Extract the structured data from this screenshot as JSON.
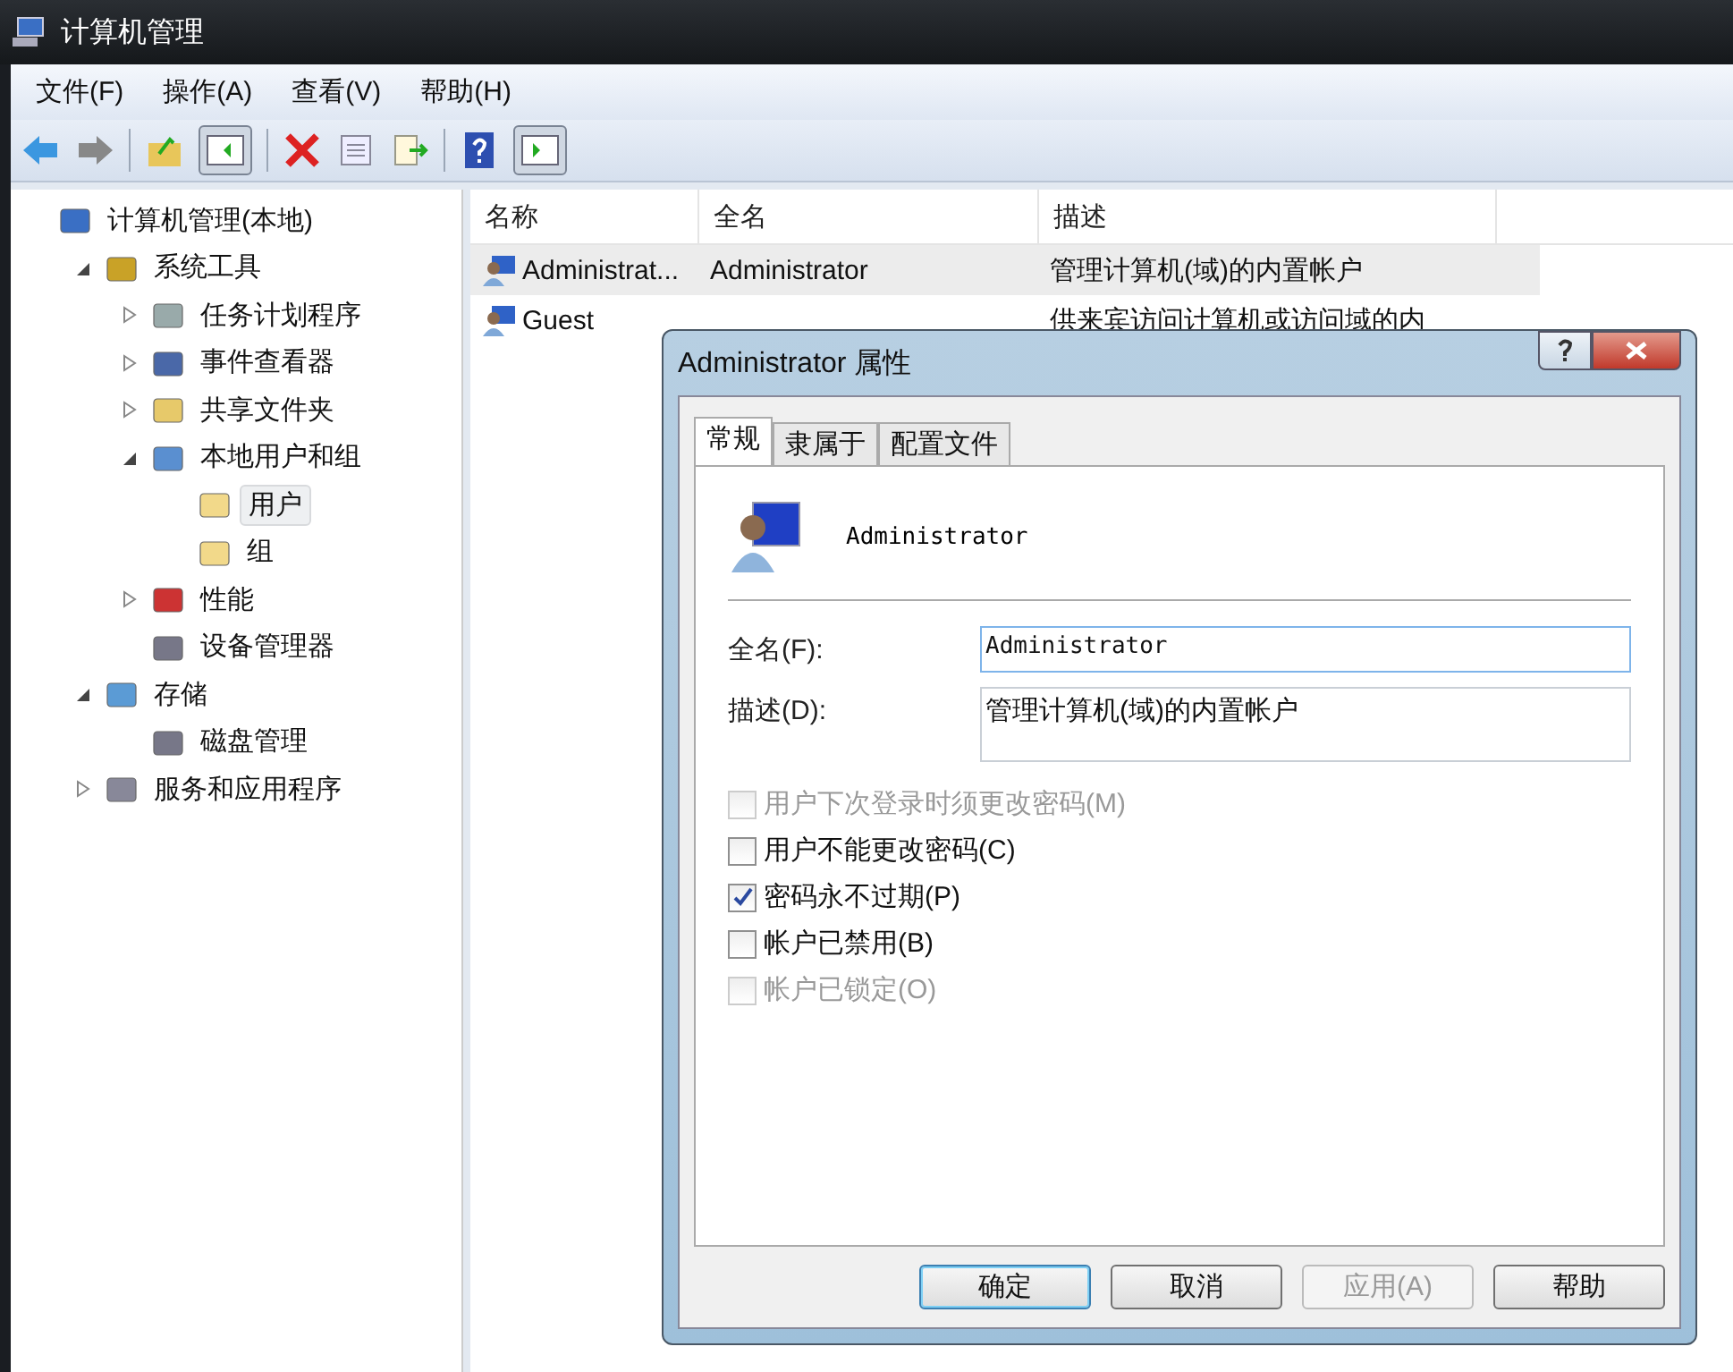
{
  "window": {
    "title": "计算机管理"
  },
  "menu": [
    "文件(F)",
    "操作(A)",
    "查看(V)",
    "帮助(H)"
  ],
  "tree": [
    {
      "label": "计算机管理(本地)",
      "selected": false,
      "children": [
        {
          "label": "系统工具",
          "expanded": true,
          "selected": false,
          "children": [
            {
              "label": "任务计划程序",
              "expanded": false,
              "selected": false
            },
            {
              "label": "事件查看器",
              "expanded": false,
              "selected": false
            },
            {
              "label": "共享文件夹",
              "expanded": false,
              "selected": false
            },
            {
              "label": "本地用户和组",
              "expanded": true,
              "selected": false,
              "children": [
                {
                  "label": "用户",
                  "selected": true
                },
                {
                  "label": "组",
                  "selected": false
                }
              ]
            },
            {
              "label": "性能",
              "expanded": false,
              "selected": false
            },
            {
              "label": "设备管理器",
              "selected": false
            }
          ]
        },
        {
          "label": "存储",
          "expanded": true,
          "selected": false,
          "children": [
            {
              "label": "磁盘管理",
              "selected": false
            }
          ]
        },
        {
          "label": "服务和应用程序",
          "expanded": false,
          "selected": false
        }
      ]
    }
  ],
  "table": {
    "columns": [
      "名称",
      "全名",
      "描述"
    ],
    "rows": [
      {
        "cells": [
          "Administrat...",
          "Administrator",
          "管理计算机(域)的内置帐户"
        ],
        "selected": true
      },
      {
        "cells": [
          "Guest",
          "",
          "供来宾访问计算机或访问域的内"
        ],
        "selected": false
      }
    ]
  },
  "dialog": {
    "title": "Administrator 属性",
    "tabs": [
      {
        "label": "常规",
        "selected": true
      },
      {
        "label": "隶属于",
        "selected": false
      },
      {
        "label": "配置文件",
        "selected": false
      }
    ],
    "user_name": "Administrator",
    "fields": [
      {
        "label": "全名(F):",
        "value": "Administrator",
        "kind": "line"
      },
      {
        "label": "描述(D):",
        "value": "管理计算机(域)的内置帐户",
        "kind": "area"
      }
    ],
    "options": [
      {
        "label": "用户下次登录时须更改密码(M)",
        "checked": false,
        "disabled": true
      },
      {
        "label": "用户不能更改密码(C)",
        "checked": false,
        "disabled": false
      },
      {
        "label": "密码永不过期(P)",
        "checked": true,
        "disabled": false
      },
      {
        "label": "帐户已禁用(B)",
        "checked": false,
        "disabled": false
      },
      {
        "label": "帐户已锁定(O)",
        "checked": false,
        "disabled": true
      }
    ],
    "buttons": [
      {
        "label": "确定",
        "default": true,
        "disabled": false
      },
      {
        "label": "取消",
        "default": false,
        "disabled": false
      },
      {
        "label": "应用(A)",
        "default": false,
        "disabled": true
      },
      {
        "label": "帮助",
        "default": false,
        "disabled": false
      }
    ]
  }
}
